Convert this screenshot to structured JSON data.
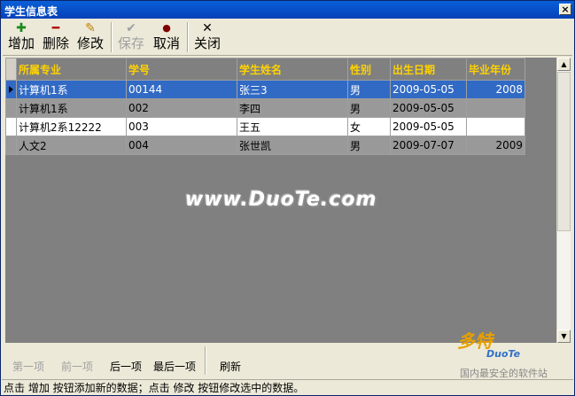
{
  "window": {
    "title": "学生信息表",
    "close_glyph": "×"
  },
  "toolbar": {
    "add": {
      "label": "增加",
      "icon": "✚"
    },
    "delete": {
      "label": "删除",
      "icon": "━"
    },
    "edit": {
      "label": "修改",
      "icon": "✎"
    },
    "save": {
      "label": "保存",
      "icon": "✔"
    },
    "cancel": {
      "label": "取消",
      "icon": "●"
    },
    "close": {
      "label": "关闭",
      "icon": "✕"
    }
  },
  "table": {
    "columns": [
      "所属专业",
      "学号",
      "学生姓名",
      "性别",
      "出生日期",
      "毕业年份"
    ],
    "rows": [
      [
        "计算机1系",
        "00144",
        "张三3",
        "男",
        "2009-05-05",
        "2008"
      ],
      [
        "计算机1系",
        "002",
        "李四",
        "男",
        "2009-05-05",
        ""
      ],
      [
        "计算机2系12222",
        "003",
        "王五",
        "女",
        "2009-05-05",
        ""
      ],
      [
        "人文2",
        "004",
        "张世凯",
        "男",
        "2009-07-07",
        "2009"
      ]
    ]
  },
  "watermark": "www.DuoTe.com",
  "nav": {
    "first": "第一项",
    "prev": "前一项",
    "next": "后一项",
    "last": "最后一项",
    "refresh": "刷新"
  },
  "status": "点击 增加 按钮添加新的数据；点击 修改 按钮修改选中的数据。",
  "logo": {
    "main": "多特",
    "sub": "DuoTe",
    "tag": "国内最安全的软件站"
  }
}
